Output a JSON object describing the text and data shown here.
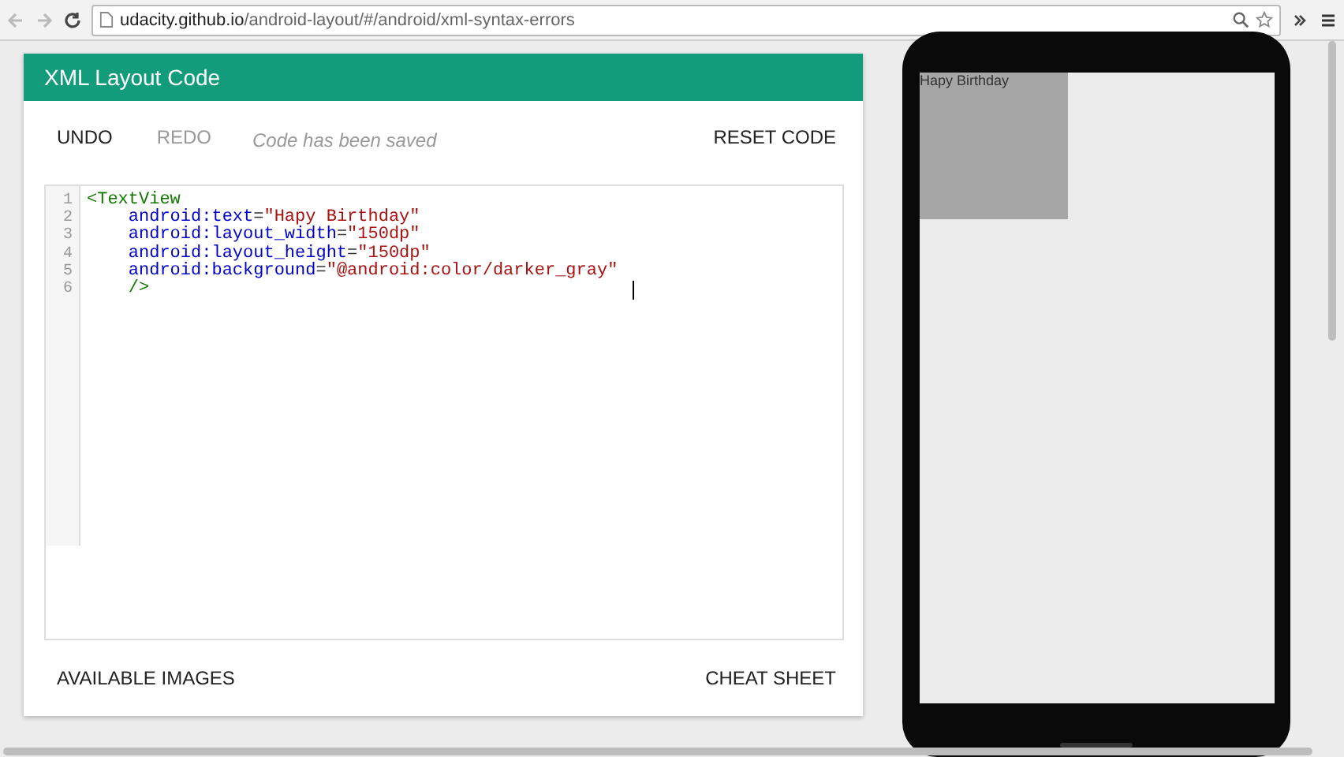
{
  "browser": {
    "url_host": "udacity.github.io",
    "url_path": "/android-layout/#/android/xml-syntax-errors"
  },
  "card": {
    "title": "XML Layout Code",
    "undo": "UNDO",
    "redo": "REDO",
    "redo_disabled": true,
    "status": "Code has been saved",
    "reset": "RESET CODE",
    "code_lines": [
      {
        "number": "1",
        "tokens": [
          {
            "kind": "tag",
            "text": "<TextView"
          }
        ]
      },
      {
        "number": "2",
        "tokens": [
          {
            "kind": "attr",
            "text": "    android:text"
          },
          {
            "kind": "punct",
            "text": "="
          },
          {
            "kind": "string",
            "text": "\"Hapy Birthday\""
          }
        ]
      },
      {
        "number": "3",
        "tokens": [
          {
            "kind": "attr",
            "text": "    android:layout_width"
          },
          {
            "kind": "punct",
            "text": "="
          },
          {
            "kind": "string",
            "text": "\"150dp\""
          }
        ]
      },
      {
        "number": "4",
        "tokens": [
          {
            "kind": "attr",
            "text": "    android:layout_height"
          },
          {
            "kind": "punct",
            "text": "="
          },
          {
            "kind": "string",
            "text": "\"150dp\""
          }
        ]
      },
      {
        "number": "5",
        "tokens": [
          {
            "kind": "attr",
            "text": "    android:background"
          },
          {
            "kind": "punct",
            "text": "="
          },
          {
            "kind": "string",
            "text": "\"@android:color/darker_gray\""
          }
        ]
      },
      {
        "number": "6",
        "tokens": [
          {
            "kind": "tag",
            "text": "    />"
          }
        ]
      }
    ],
    "available_images": "AVAILABLE IMAGES",
    "cheat_sheet": "CHEAT SHEET"
  },
  "preview": {
    "text_view": "Hapy Birthday"
  }
}
